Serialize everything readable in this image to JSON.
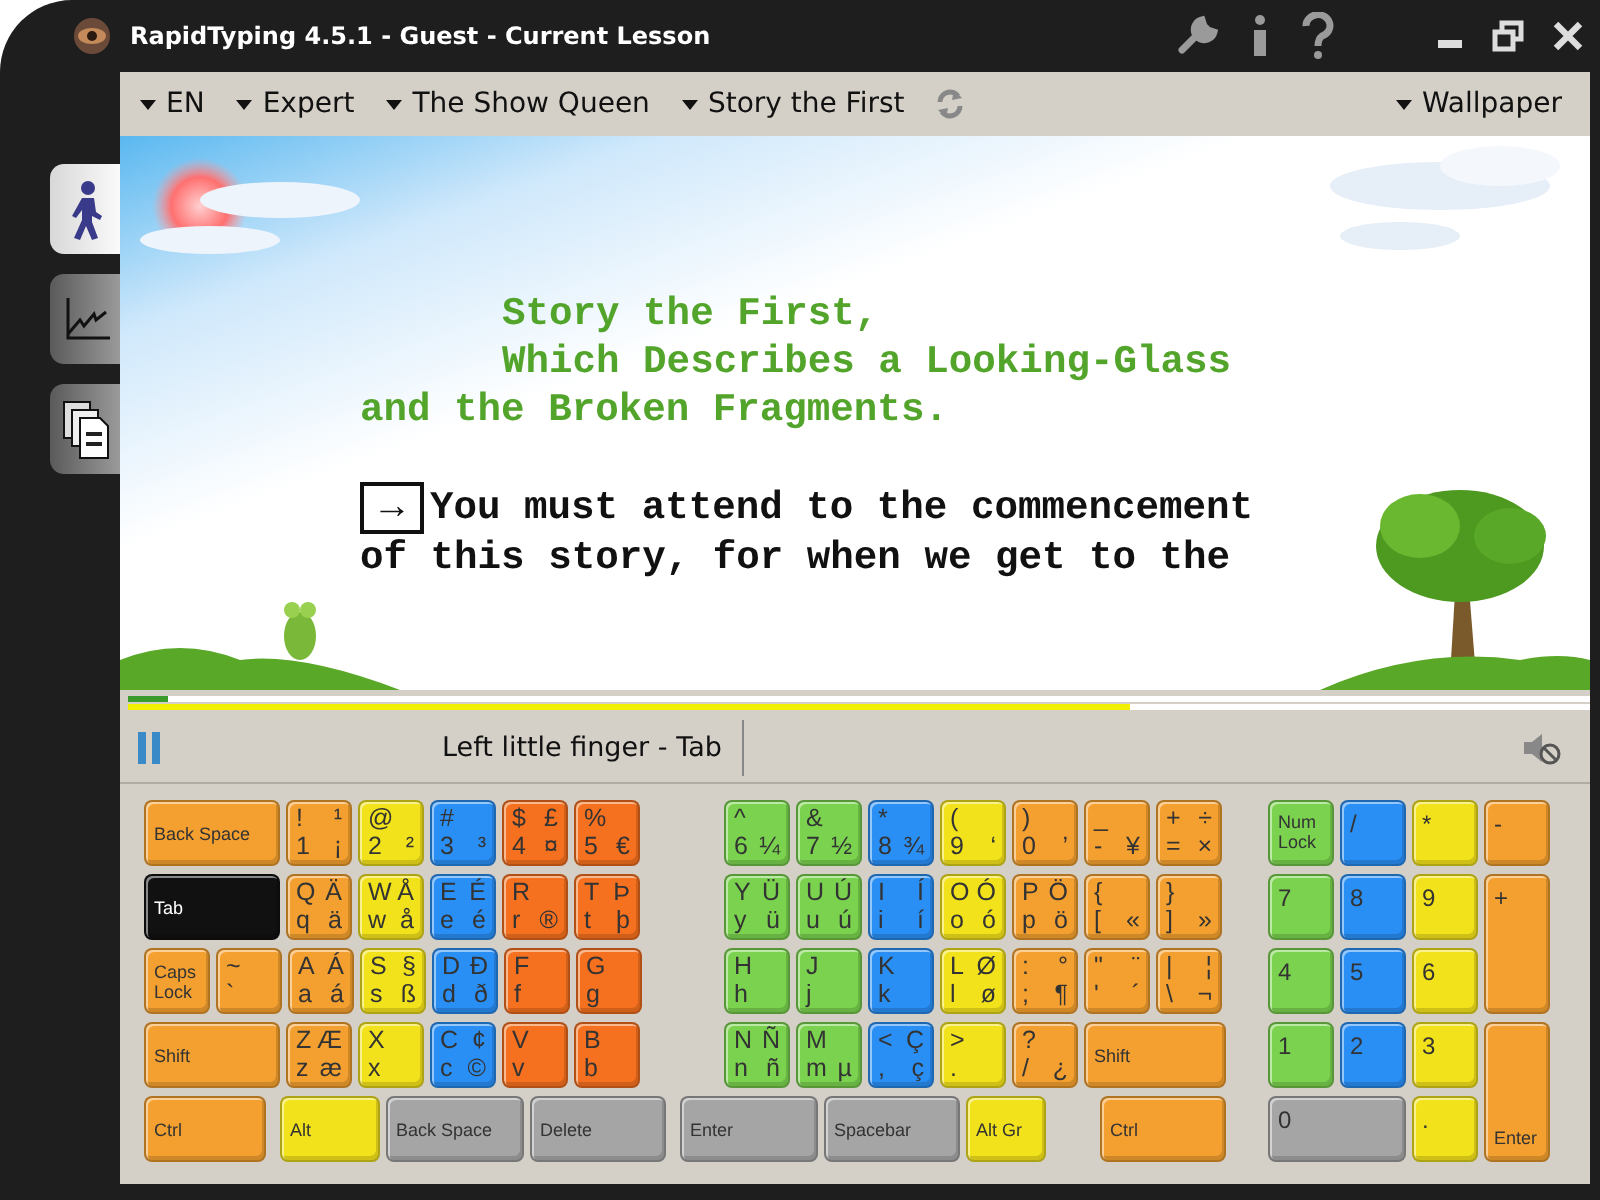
{
  "window": {
    "title": "RapidTyping 4.5.1 - Guest - Current Lesson"
  },
  "toolbar": {
    "menus": [
      {
        "label": "EN"
      },
      {
        "label": "Expert"
      },
      {
        "label": "The Show Queen"
      },
      {
        "label": "Story the First"
      }
    ],
    "wallpaper": {
      "label": "Wallpaper"
    }
  },
  "sidebar": {
    "tabs": [
      {
        "kind": "lesson",
        "selected": true
      },
      {
        "kind": "statistics",
        "selected": false
      },
      {
        "kind": "editor",
        "selected": false
      }
    ]
  },
  "lesson": {
    "title_lines": [
      "Story the First,",
      "Which Describes a Looking-Glass",
      "and the Broken Fragments."
    ],
    "cursor_char": "→",
    "text_lines": [
      "You must attend to the commencement",
      "of this story, for when we get to the"
    ]
  },
  "progress_bars": [
    {
      "level": 0.028
    },
    {
      "level": 0.685
    }
  ],
  "status": {
    "hint": "Left little finger - Tab"
  },
  "keyboard": {
    "rows": [
      {
        "keys": [
          {
            "label": "Back Space",
            "color": "#f4a030",
            "selected": false
          },
          {
            "tl": "!",
            "tr": "¹",
            "bl": "1",
            "br": "¡",
            "color": "#f4a030",
            "selected": false
          },
          {
            "tl": "@",
            "bl": "2",
            "br": "²",
            "color": "#f2e21c",
            "selected": false
          },
          {
            "tl": "#",
            "bl": "3",
            "br": "³",
            "color": "#2a8ff5",
            "selected": false
          },
          {
            "tl": "$",
            "tr": "£",
            "bl": "4",
            "br": "¤",
            "color": "#f5701f",
            "selected": false
          },
          {
            "tl": "%",
            "bl": "5",
            "br": "€",
            "color": "#f5701f",
            "selected": false
          },
          {
            "tl": "^",
            "bl": "6",
            "br": "¼",
            "color": "#7ad24e",
            "selected": false
          },
          {
            "tl": "&",
            "bl": "7",
            "br": "½",
            "color": "#7ad24e",
            "selected": false
          },
          {
            "tl": "*",
            "bl": "8",
            "br": "¾",
            "color": "#2a8ff5",
            "selected": false
          },
          {
            "tl": "(",
            "bl": "9",
            "br": "‘",
            "color": "#f2e21c",
            "selected": false
          },
          {
            "tl": ")",
            "bl": "0",
            "br": "’",
            "color": "#f4a030",
            "selected": false
          },
          {
            "tl": "_",
            "bl": "-",
            "br": "¥",
            "color": "#f4a030",
            "selected": false
          },
          {
            "tl": "+",
            "tr": "÷",
            "bl": "=",
            "br": "×",
            "color": "#f4a030",
            "selected": false
          }
        ]
      },
      {
        "keys": [
          {
            "label": "Tab",
            "selected": true
          },
          {
            "tl": "Q",
            "tr": "Ä",
            "bl": "q",
            "br": "ä",
            "color": "#f4a030",
            "selected": false
          },
          {
            "tl": "W",
            "tr": "Å",
            "bl": "w",
            "br": "å",
            "color": "#f2e21c",
            "selected": false
          },
          {
            "tl": "E",
            "tr": "É",
            "bl": "e",
            "br": "é",
            "color": "#2a8ff5",
            "selected": false
          },
          {
            "tl": "R",
            "bl": "r",
            "br": "®",
            "color": "#f5701f",
            "selected": false
          },
          {
            "tl": "T",
            "tr": "Þ",
            "bl": "t",
            "br": "þ",
            "color": "#f5701f",
            "selected": false
          },
          {
            "tl": "Y",
            "tr": "Ü",
            "bl": "y",
            "br": "ü",
            "color": "#7ad24e",
            "selected": false
          },
          {
            "tl": "U",
            "tr": "Ú",
            "bl": "u",
            "br": "ú",
            "color": "#7ad24e",
            "selected": false
          },
          {
            "tl": "I",
            "tr": "Í",
            "bl": "i",
            "br": "í",
            "color": "#2a8ff5",
            "selected": false
          },
          {
            "tl": "O",
            "tr": "Ó",
            "bl": "o",
            "br": "ó",
            "color": "#f2e21c",
            "selected": false
          },
          {
            "tl": "P",
            "tr": "Ö",
            "bl": "p",
            "br": "ö",
            "color": "#f4a030",
            "selected": false
          },
          {
            "tl": "{",
            "bl": "[",
            "br": "«",
            "color": "#f4a030",
            "selected": false
          },
          {
            "tl": "}",
            "bl": "]",
            "br": "»",
            "color": "#f4a030",
            "selected": false
          }
        ]
      },
      {
        "keys": [
          {
            "label": "Caps Lock",
            "color": "#f4a030",
            "selected": false
          },
          {
            "tl": "~",
            "bl": "`",
            "color": "#f4a030",
            "selected": false
          },
          {
            "tl": "A",
            "tr": "Á",
            "bl": "a",
            "br": "á",
            "color": "#f4a030",
            "selected": false
          },
          {
            "tl": "S",
            "tr": "§",
            "bl": "s",
            "br": "ß",
            "color": "#f2e21c",
            "selected": false
          },
          {
            "tl": "D",
            "tr": "Ð",
            "bl": "d",
            "br": "ð",
            "color": "#2a8ff5",
            "selected": false
          },
          {
            "tl": "F",
            "bl": "f",
            "color": "#f5701f",
            "selected": false
          },
          {
            "tl": "G",
            "bl": "g",
            "color": "#f5701f",
            "selected": false
          },
          {
            "tl": "H",
            "bl": "h",
            "color": "#7ad24e",
            "selected": false
          },
          {
            "tl": "J",
            "bl": "j",
            "color": "#7ad24e",
            "selected": false
          },
          {
            "tl": "K",
            "bl": "k",
            "color": "#2a8ff5",
            "selected": false
          },
          {
            "tl": "L",
            "tr": "Ø",
            "bl": "l",
            "br": "ø",
            "color": "#f2e21c",
            "selected": false
          },
          {
            "tl": ":",
            "tr": "°",
            "bl": ";",
            "br": "¶",
            "color": "#f4a030",
            "selected": false
          },
          {
            "tl": "\"",
            "tr": "¨",
            "bl": "'",
            "br": "´",
            "color": "#f4a030",
            "selected": false
          },
          {
            "tl": "|",
            "tr": "¦",
            "bl": "\\",
            "br": "¬",
            "color": "#f4a030",
            "selected": false
          }
        ]
      },
      {
        "keys": [
          {
            "label": "Shift",
            "color": "#f4a030",
            "selected": false
          },
          {
            "tl": "Z",
            "tr": "Æ",
            "bl": "z",
            "br": "æ",
            "color": "#f4a030",
            "selected": false
          },
          {
            "tl": "X",
            "bl": "x",
            "color": "#f2e21c",
            "selected": false
          },
          {
            "tl": "C",
            "tr": "¢",
            "bl": "c",
            "br": "©",
            "color": "#2a8ff5",
            "selected": false
          },
          {
            "tl": "V",
            "bl": "v",
            "color": "#f5701f",
            "selected": false
          },
          {
            "tl": "B",
            "bl": "b",
            "color": "#f5701f",
            "selected": false
          },
          {
            "tl": "N",
            "tr": "Ñ",
            "bl": "n",
            "br": "ñ",
            "color": "#7ad24e",
            "selected": false
          },
          {
            "tl": "M",
            "bl": "m",
            "br": "µ",
            "color": "#7ad24e",
            "selected": false
          },
          {
            "tl": "<",
            "tr": "Ç",
            "bl": ",",
            "br": "ç",
            "color": "#2a8ff5",
            "selected": false
          },
          {
            "tl": ">",
            "bl": ".",
            "color": "#f2e21c",
            "selected": false
          },
          {
            "tl": "?",
            "bl": "/",
            "br": "¿",
            "color": "#f4a030",
            "selected": false
          },
          {
            "label": "Shift",
            "color": "#f4a030",
            "selected": false
          }
        ]
      },
      {
        "keys": [
          {
            "label": "Ctrl",
            "color": "#f4a030",
            "selected": false
          },
          {
            "label": "Alt",
            "color": "#f2e21c",
            "selected": false
          },
          {
            "label": "Back Space",
            "color": "#a5a5a5",
            "selected": false
          },
          {
            "label": "Delete",
            "color": "#a5a5a5",
            "selected": false
          },
          {
            "label": "Enter",
            "color": "#a5a5a5",
            "selected": false
          },
          {
            "label": "Spacebar",
            "color": "#a5a5a5",
            "selected": false
          },
          {
            "label": "Alt Gr",
            "color": "#f2e21c",
            "selected": false
          },
          {
            "label": "Ctrl",
            "color": "#f4a030",
            "selected": false
          }
        ]
      }
    ],
    "numpad": [
      {
        "label": "Num Lock",
        "color": "#7ad24e",
        "selected": false
      },
      {
        "label": "/",
        "color": "#2a8ff5",
        "selected": false
      },
      {
        "label": "*",
        "color": "#f2e21c",
        "selected": false
      },
      {
        "label": "-",
        "color": "#f4a030",
        "selected": false
      },
      {
        "label": "7",
        "color": "#7ad24e",
        "selected": false
      },
      {
        "label": "8",
        "color": "#2a8ff5",
        "selected": false
      },
      {
        "label": "9",
        "color": "#f2e21c",
        "selected": false
      },
      {
        "label": "+",
        "color": "#f4a030",
        "selected": false
      },
      {
        "label": "4",
        "color": "#7ad24e",
        "selected": false
      },
      {
        "label": "5",
        "color": "#2a8ff5",
        "selected": false
      },
      {
        "label": "6",
        "color": "#f2e21c",
        "selected": false
      },
      {
        "label": "1",
        "color": "#7ad24e",
        "selected": false
      },
      {
        "label": "2",
        "color": "#2a8ff5",
        "selected": false
      },
      {
        "label": "3",
        "color": "#f2e21c",
        "selected": false
      },
      {
        "label": "Enter",
        "color": "#f4a030",
        "selected": false
      },
      {
        "label": "0",
        "color": "#a5a5a5",
        "selected": false
      },
      {
        "label": ".",
        "color": "#f2e21c",
        "selected": false
      }
    ]
  }
}
